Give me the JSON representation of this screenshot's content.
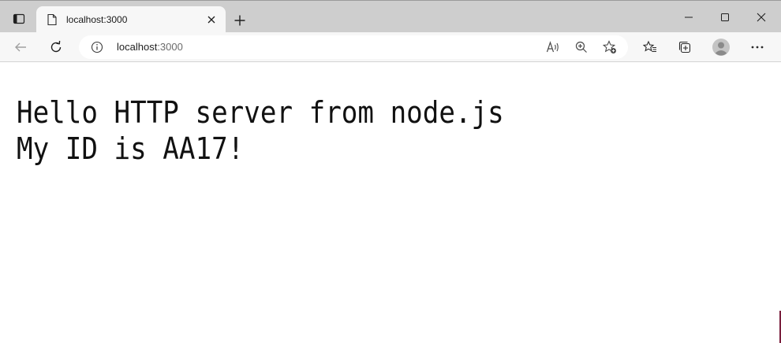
{
  "tab": {
    "title": "localhost:3000"
  },
  "address": {
    "host": "localhost",
    "port": ":3000"
  },
  "page": {
    "lines": [
      "Hello HTTP server from node.js",
      "My ID is AA17!"
    ]
  },
  "icons": {
    "tab_actions": "tab-actions-icon",
    "favicon": "document-icon",
    "tab_close": "close-icon",
    "new_tab": "plus-icon",
    "minimize": "minimize-icon",
    "maximize": "maximize-icon",
    "close_window": "close-icon",
    "back": "back-arrow-icon",
    "reload": "reload-icon",
    "site_info": "info-icon",
    "read_aloud": "read-aloud-icon",
    "zoom": "zoom-icon",
    "add_favorite": "star-add-icon",
    "favorites": "favorites-icon",
    "collections": "collections-icon",
    "profile": "profile-icon",
    "more": "more-icon"
  },
  "colors": {
    "tabstrip": "#cecece",
    "toolbar": "#f7f7f7",
    "page": "#ffffff"
  }
}
